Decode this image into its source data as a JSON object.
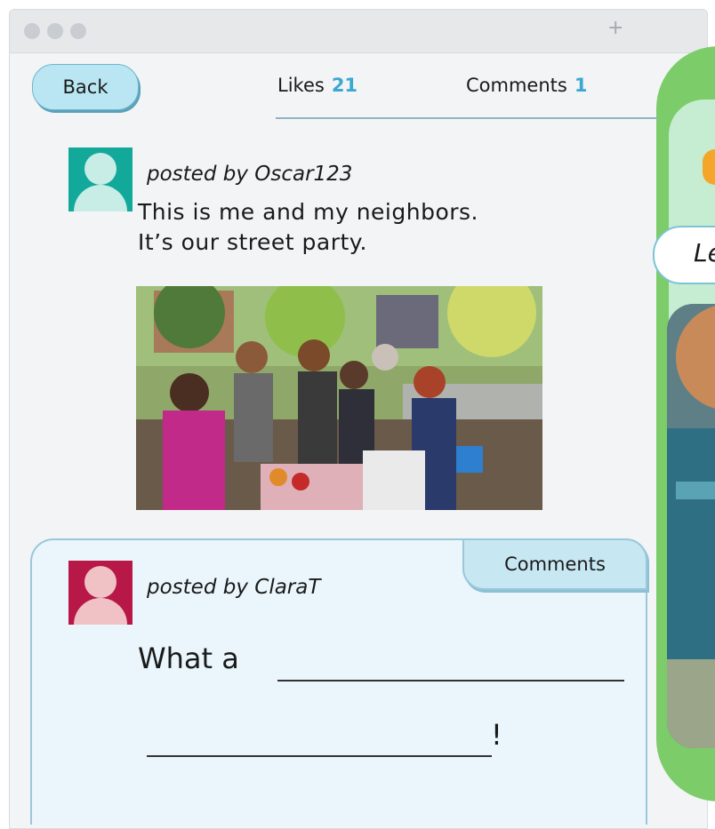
{
  "window": {
    "titlebar": {
      "new_tab_symbol": "+"
    }
  },
  "nav": {
    "back_label": "Back",
    "tabs": [
      {
        "label": "Likes",
        "count": "21"
      },
      {
        "label": "Comments",
        "count": "1"
      }
    ]
  },
  "post": {
    "author_line": "posted by Oscar123",
    "avatar_color": "#12a99a",
    "text_lines": [
      "This is me and my neighbors.",
      "It’s our street party."
    ],
    "photo_icon": "street-party-photo"
  },
  "comment": {
    "tab_label": "Comments",
    "author_line": "posted by ClaraT",
    "avatar_color": "#b81848",
    "prompt_start": "What a",
    "prompt_end": "!"
  },
  "side_panel": {
    "label_fragment": "Le"
  },
  "colors": {
    "accent": "#3aa8d0",
    "button_bg": "#b9e6f2",
    "card_bg": "#eaf6fc",
    "panel_green": "#7ccc6a"
  }
}
